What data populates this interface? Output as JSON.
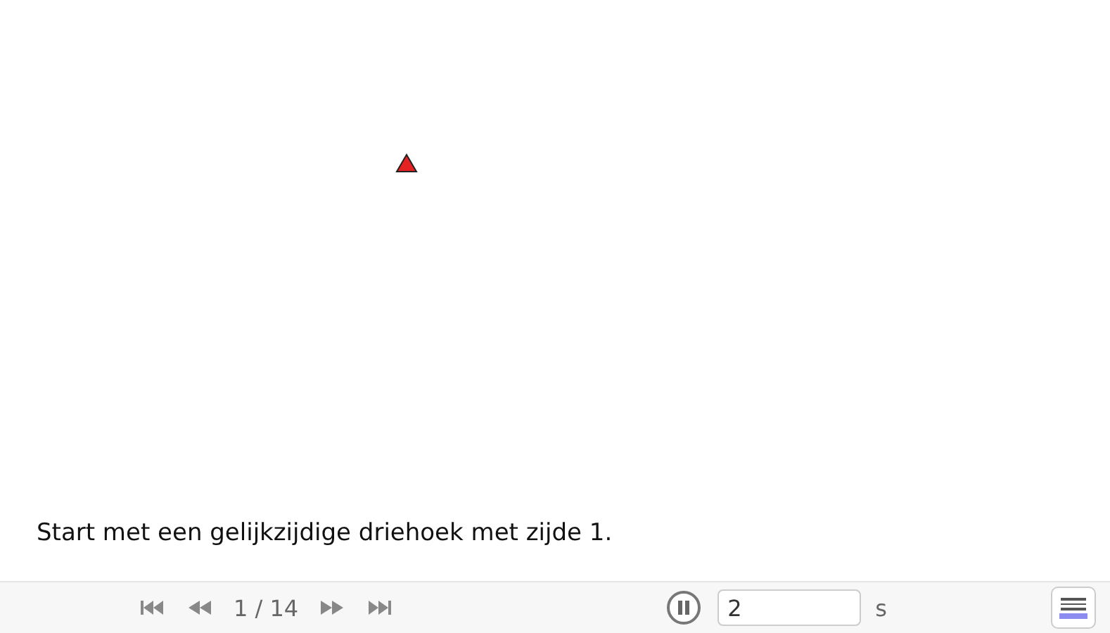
{
  "caption": "Start met een gelijkzijdige driehoek met zijde 1.",
  "player": {
    "position": "1 / 14",
    "playing": true,
    "interval": "2",
    "unit": "s"
  }
}
